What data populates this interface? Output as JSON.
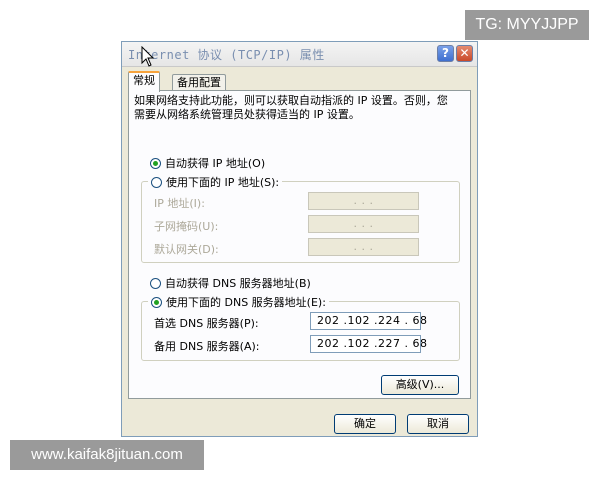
{
  "watermarks": {
    "top": "TG: MYYJJPP",
    "bottom": "www.kaifak8jituan.com"
  },
  "dialog": {
    "title": "Internet 协议 (TCP/IP) 属性",
    "help_label": "?",
    "close_label": "✕",
    "tabs": [
      {
        "label": "常规"
      },
      {
        "label": "备用配置"
      }
    ],
    "description": "如果网络支持此功能，则可以获取自动指派的 IP 设置。否则，您需要从网络系统管理员处获得适当的 IP 设置。",
    "ip": {
      "auto_label": "自动获得 IP 地址(O)",
      "manual_label": "使用下面的 IP 地址(S):",
      "address_label": "IP 地址(I):",
      "subnet_label": "子网掩码(U):",
      "gateway_label": "默认网关(D):",
      "empty_value": ".       .       ."
    },
    "dns": {
      "auto_label": "自动获得 DNS 服务器地址(B)",
      "manual_label": "使用下面的 DNS 服务器地址(E):",
      "preferred_label": "首选 DNS 服务器(P):",
      "preferred_value": "202 .102 .224 . 68",
      "alternate_label": "备用 DNS 服务器(A):",
      "alternate_value": "202 .102 .227 . 68"
    },
    "advanced_label": "高级(V)...",
    "ok_label": "确定",
    "cancel_label": "取消"
  },
  "colors": {
    "accent_tab": "#f7a33c",
    "radio_dot": "#21a121",
    "dialog_bg": "#ece9d8"
  }
}
